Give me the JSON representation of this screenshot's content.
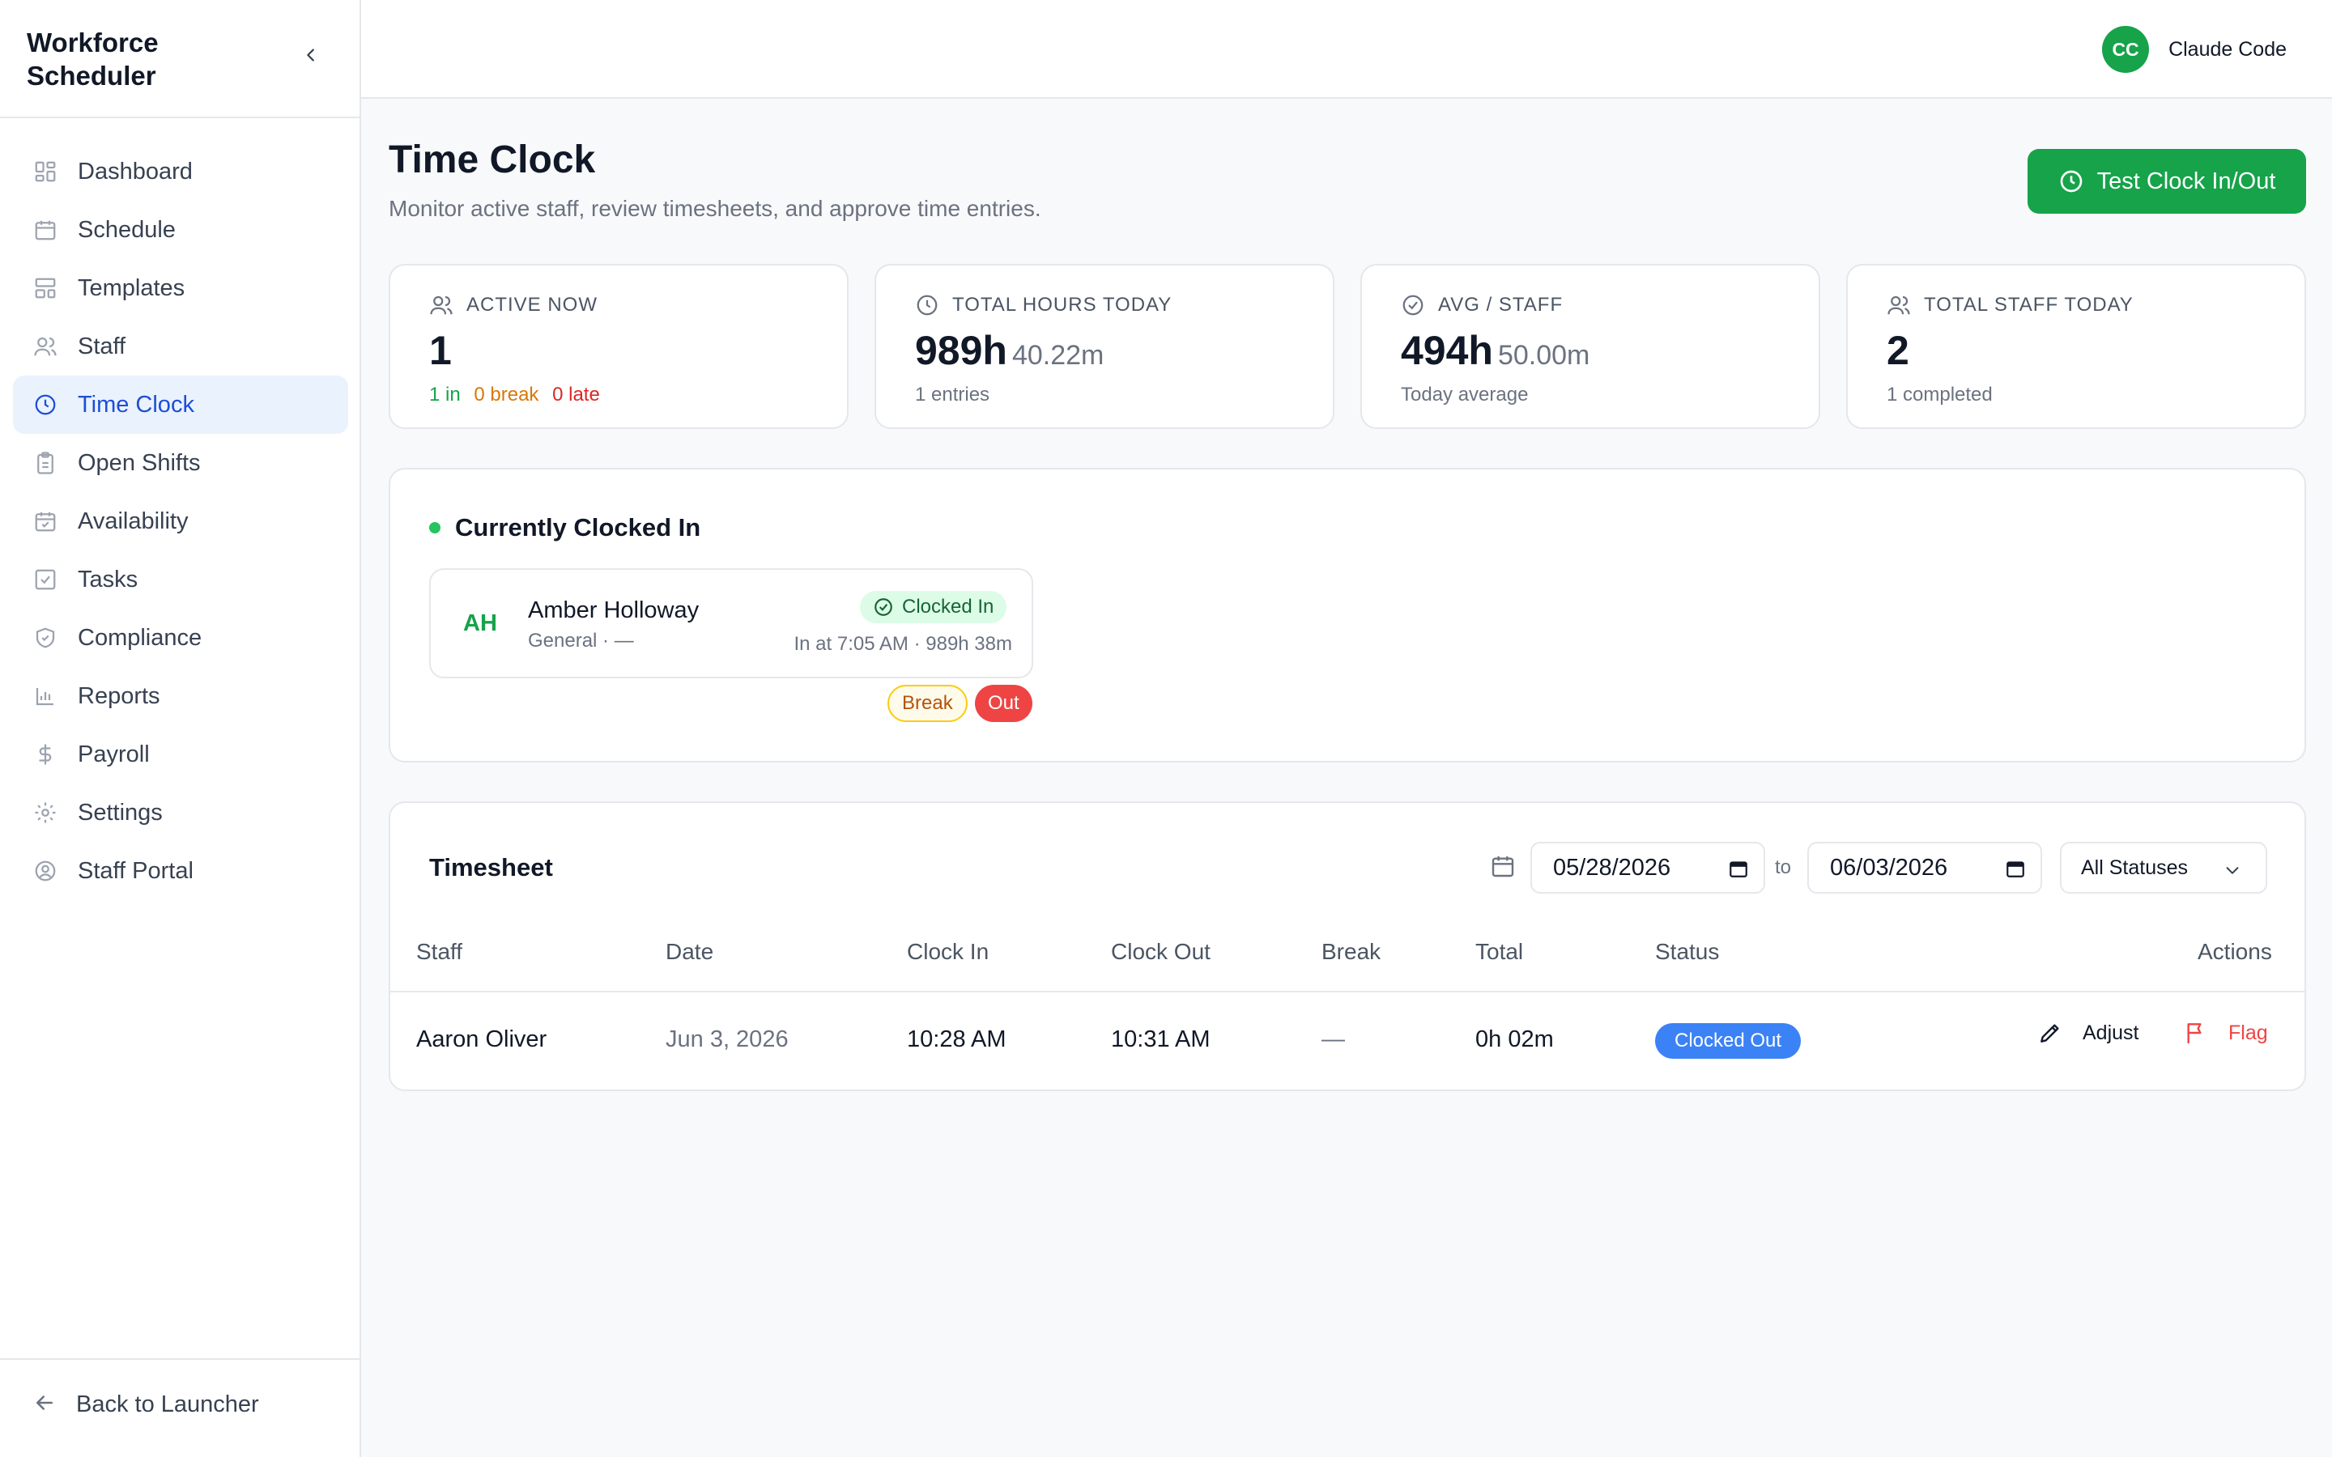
{
  "app": {
    "title": "Workforce Scheduler"
  },
  "sidebar": {
    "items": [
      {
        "label": "Dashboard",
        "icon": "dashboard-icon"
      },
      {
        "label": "Schedule",
        "icon": "calendar-icon"
      },
      {
        "label": "Templates",
        "icon": "templates-icon"
      },
      {
        "label": "Staff",
        "icon": "users-icon"
      },
      {
        "label": "Time Clock",
        "icon": "clock-icon",
        "active": true
      },
      {
        "label": "Open Shifts",
        "icon": "clipboard-icon"
      },
      {
        "label": "Availability",
        "icon": "calendar-check-icon"
      },
      {
        "label": "Tasks",
        "icon": "checkbox-icon"
      },
      {
        "label": "Compliance",
        "icon": "shield-icon"
      },
      {
        "label": "Reports",
        "icon": "bar-chart-icon"
      },
      {
        "label": "Payroll",
        "icon": "dollar-icon"
      },
      {
        "label": "Settings",
        "icon": "gear-icon"
      },
      {
        "label": "Staff Portal",
        "icon": "user-circle-icon"
      }
    ],
    "footer_label": "Back to Launcher"
  },
  "topbar": {
    "user_initials": "CC",
    "user_name": "Claude Code"
  },
  "header": {
    "title": "Time Clock",
    "subtitle": "Monitor active staff, review timesheets, and approve time entries.",
    "primary_button": "Test Clock In/Out"
  },
  "stats": [
    {
      "label": "ACTIVE NOW",
      "value": "1",
      "sub": "",
      "in": "1 in",
      "break": "0 break",
      "late": "0 late"
    },
    {
      "label": "TOTAL HOURS TODAY",
      "value": "989h",
      "sub": "40.22m",
      "foot": "1 entries"
    },
    {
      "label": "AVG / STAFF",
      "value": "494h",
      "sub": "50.00m",
      "foot": "Today average"
    },
    {
      "label": "TOTAL STAFF TODAY",
      "value": "2",
      "sub": "",
      "foot": "1 completed"
    }
  ],
  "clocked_in": {
    "title": "Currently Clocked In",
    "employees": [
      {
        "initials": "AH",
        "name": "Amber Holloway",
        "role": "General · —",
        "status": "Clocked In",
        "time": "In at 7:05 AM · 989h 38m",
        "break_label": "Break",
        "out_label": "Out"
      }
    ]
  },
  "timesheet": {
    "title": "Timesheet",
    "from_date": "05/28/2026",
    "to_label": "to",
    "to_date": "06/03/2026",
    "status_filter": "All Statuses",
    "columns": [
      "Staff",
      "Date",
      "Clock In",
      "Clock Out",
      "Break",
      "Total",
      "Status",
      "Actions"
    ],
    "rows": [
      {
        "staff": "Aaron Oliver",
        "date": "Jun 3, 2026",
        "clock_in": "10:28 AM",
        "clock_out": "10:31 AM",
        "break": "—",
        "total": "0h 02m",
        "status": "Clocked Out",
        "adjust_label": "Adjust",
        "flag_label": "Flag"
      }
    ]
  },
  "colors": {
    "primary": "#16a34a",
    "active_nav_bg": "#eaf2fe",
    "active_nav_text": "#1d4ed8",
    "status_out": "#3b82f6",
    "danger": "#ef4444",
    "warning": "#d97706"
  }
}
